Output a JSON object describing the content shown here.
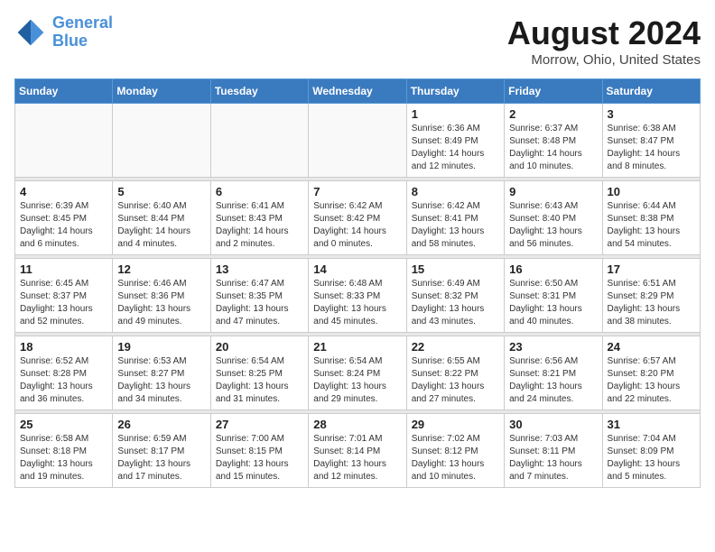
{
  "header": {
    "logo_line1": "General",
    "logo_line2": "Blue",
    "month_year": "August 2024",
    "location": "Morrow, Ohio, United States"
  },
  "weekdays": [
    "Sunday",
    "Monday",
    "Tuesday",
    "Wednesday",
    "Thursday",
    "Friday",
    "Saturday"
  ],
  "weeks": [
    [
      {
        "day": "",
        "sunrise": "",
        "sunset": "",
        "daylight": "",
        "empty": true
      },
      {
        "day": "",
        "sunrise": "",
        "sunset": "",
        "daylight": "",
        "empty": true
      },
      {
        "day": "",
        "sunrise": "",
        "sunset": "",
        "daylight": "",
        "empty": true
      },
      {
        "day": "",
        "sunrise": "",
        "sunset": "",
        "daylight": "",
        "empty": true
      },
      {
        "day": "1",
        "sunrise": "Sunrise: 6:36 AM",
        "sunset": "Sunset: 8:49 PM",
        "daylight": "Daylight: 14 hours and 12 minutes.",
        "empty": false
      },
      {
        "day": "2",
        "sunrise": "Sunrise: 6:37 AM",
        "sunset": "Sunset: 8:48 PM",
        "daylight": "Daylight: 14 hours and 10 minutes.",
        "empty": false
      },
      {
        "day": "3",
        "sunrise": "Sunrise: 6:38 AM",
        "sunset": "Sunset: 8:47 PM",
        "daylight": "Daylight: 14 hours and 8 minutes.",
        "empty": false
      }
    ],
    [
      {
        "day": "4",
        "sunrise": "Sunrise: 6:39 AM",
        "sunset": "Sunset: 8:45 PM",
        "daylight": "Daylight: 14 hours and 6 minutes.",
        "empty": false
      },
      {
        "day": "5",
        "sunrise": "Sunrise: 6:40 AM",
        "sunset": "Sunset: 8:44 PM",
        "daylight": "Daylight: 14 hours and 4 minutes.",
        "empty": false
      },
      {
        "day": "6",
        "sunrise": "Sunrise: 6:41 AM",
        "sunset": "Sunset: 8:43 PM",
        "daylight": "Daylight: 14 hours and 2 minutes.",
        "empty": false
      },
      {
        "day": "7",
        "sunrise": "Sunrise: 6:42 AM",
        "sunset": "Sunset: 8:42 PM",
        "daylight": "Daylight: 14 hours and 0 minutes.",
        "empty": false
      },
      {
        "day": "8",
        "sunrise": "Sunrise: 6:42 AM",
        "sunset": "Sunset: 8:41 PM",
        "daylight": "Daylight: 13 hours and 58 minutes.",
        "empty": false
      },
      {
        "day": "9",
        "sunrise": "Sunrise: 6:43 AM",
        "sunset": "Sunset: 8:40 PM",
        "daylight": "Daylight: 13 hours and 56 minutes.",
        "empty": false
      },
      {
        "day": "10",
        "sunrise": "Sunrise: 6:44 AM",
        "sunset": "Sunset: 8:38 PM",
        "daylight": "Daylight: 13 hours and 54 minutes.",
        "empty": false
      }
    ],
    [
      {
        "day": "11",
        "sunrise": "Sunrise: 6:45 AM",
        "sunset": "Sunset: 8:37 PM",
        "daylight": "Daylight: 13 hours and 52 minutes.",
        "empty": false
      },
      {
        "day": "12",
        "sunrise": "Sunrise: 6:46 AM",
        "sunset": "Sunset: 8:36 PM",
        "daylight": "Daylight: 13 hours and 49 minutes.",
        "empty": false
      },
      {
        "day": "13",
        "sunrise": "Sunrise: 6:47 AM",
        "sunset": "Sunset: 8:35 PM",
        "daylight": "Daylight: 13 hours and 47 minutes.",
        "empty": false
      },
      {
        "day": "14",
        "sunrise": "Sunrise: 6:48 AM",
        "sunset": "Sunset: 8:33 PM",
        "daylight": "Daylight: 13 hours and 45 minutes.",
        "empty": false
      },
      {
        "day": "15",
        "sunrise": "Sunrise: 6:49 AM",
        "sunset": "Sunset: 8:32 PM",
        "daylight": "Daylight: 13 hours and 43 minutes.",
        "empty": false
      },
      {
        "day": "16",
        "sunrise": "Sunrise: 6:50 AM",
        "sunset": "Sunset: 8:31 PM",
        "daylight": "Daylight: 13 hours and 40 minutes.",
        "empty": false
      },
      {
        "day": "17",
        "sunrise": "Sunrise: 6:51 AM",
        "sunset": "Sunset: 8:29 PM",
        "daylight": "Daylight: 13 hours and 38 minutes.",
        "empty": false
      }
    ],
    [
      {
        "day": "18",
        "sunrise": "Sunrise: 6:52 AM",
        "sunset": "Sunset: 8:28 PM",
        "daylight": "Daylight: 13 hours and 36 minutes.",
        "empty": false
      },
      {
        "day": "19",
        "sunrise": "Sunrise: 6:53 AM",
        "sunset": "Sunset: 8:27 PM",
        "daylight": "Daylight: 13 hours and 34 minutes.",
        "empty": false
      },
      {
        "day": "20",
        "sunrise": "Sunrise: 6:54 AM",
        "sunset": "Sunset: 8:25 PM",
        "daylight": "Daylight: 13 hours and 31 minutes.",
        "empty": false
      },
      {
        "day": "21",
        "sunrise": "Sunrise: 6:54 AM",
        "sunset": "Sunset: 8:24 PM",
        "daylight": "Daylight: 13 hours and 29 minutes.",
        "empty": false
      },
      {
        "day": "22",
        "sunrise": "Sunrise: 6:55 AM",
        "sunset": "Sunset: 8:22 PM",
        "daylight": "Daylight: 13 hours and 27 minutes.",
        "empty": false
      },
      {
        "day": "23",
        "sunrise": "Sunrise: 6:56 AM",
        "sunset": "Sunset: 8:21 PM",
        "daylight": "Daylight: 13 hours and 24 minutes.",
        "empty": false
      },
      {
        "day": "24",
        "sunrise": "Sunrise: 6:57 AM",
        "sunset": "Sunset: 8:20 PM",
        "daylight": "Daylight: 13 hours and 22 minutes.",
        "empty": false
      }
    ],
    [
      {
        "day": "25",
        "sunrise": "Sunrise: 6:58 AM",
        "sunset": "Sunset: 8:18 PM",
        "daylight": "Daylight: 13 hours and 19 minutes.",
        "empty": false
      },
      {
        "day": "26",
        "sunrise": "Sunrise: 6:59 AM",
        "sunset": "Sunset: 8:17 PM",
        "daylight": "Daylight: 13 hours and 17 minutes.",
        "empty": false
      },
      {
        "day": "27",
        "sunrise": "Sunrise: 7:00 AM",
        "sunset": "Sunset: 8:15 PM",
        "daylight": "Daylight: 13 hours and 15 minutes.",
        "empty": false
      },
      {
        "day": "28",
        "sunrise": "Sunrise: 7:01 AM",
        "sunset": "Sunset: 8:14 PM",
        "daylight": "Daylight: 13 hours and 12 minutes.",
        "empty": false
      },
      {
        "day": "29",
        "sunrise": "Sunrise: 7:02 AM",
        "sunset": "Sunset: 8:12 PM",
        "daylight": "Daylight: 13 hours and 10 minutes.",
        "empty": false
      },
      {
        "day": "30",
        "sunrise": "Sunrise: 7:03 AM",
        "sunset": "Sunset: 8:11 PM",
        "daylight": "Daylight: 13 hours and 7 minutes.",
        "empty": false
      },
      {
        "day": "31",
        "sunrise": "Sunrise: 7:04 AM",
        "sunset": "Sunset: 8:09 PM",
        "daylight": "Daylight: 13 hours and 5 minutes.",
        "empty": false
      }
    ]
  ]
}
